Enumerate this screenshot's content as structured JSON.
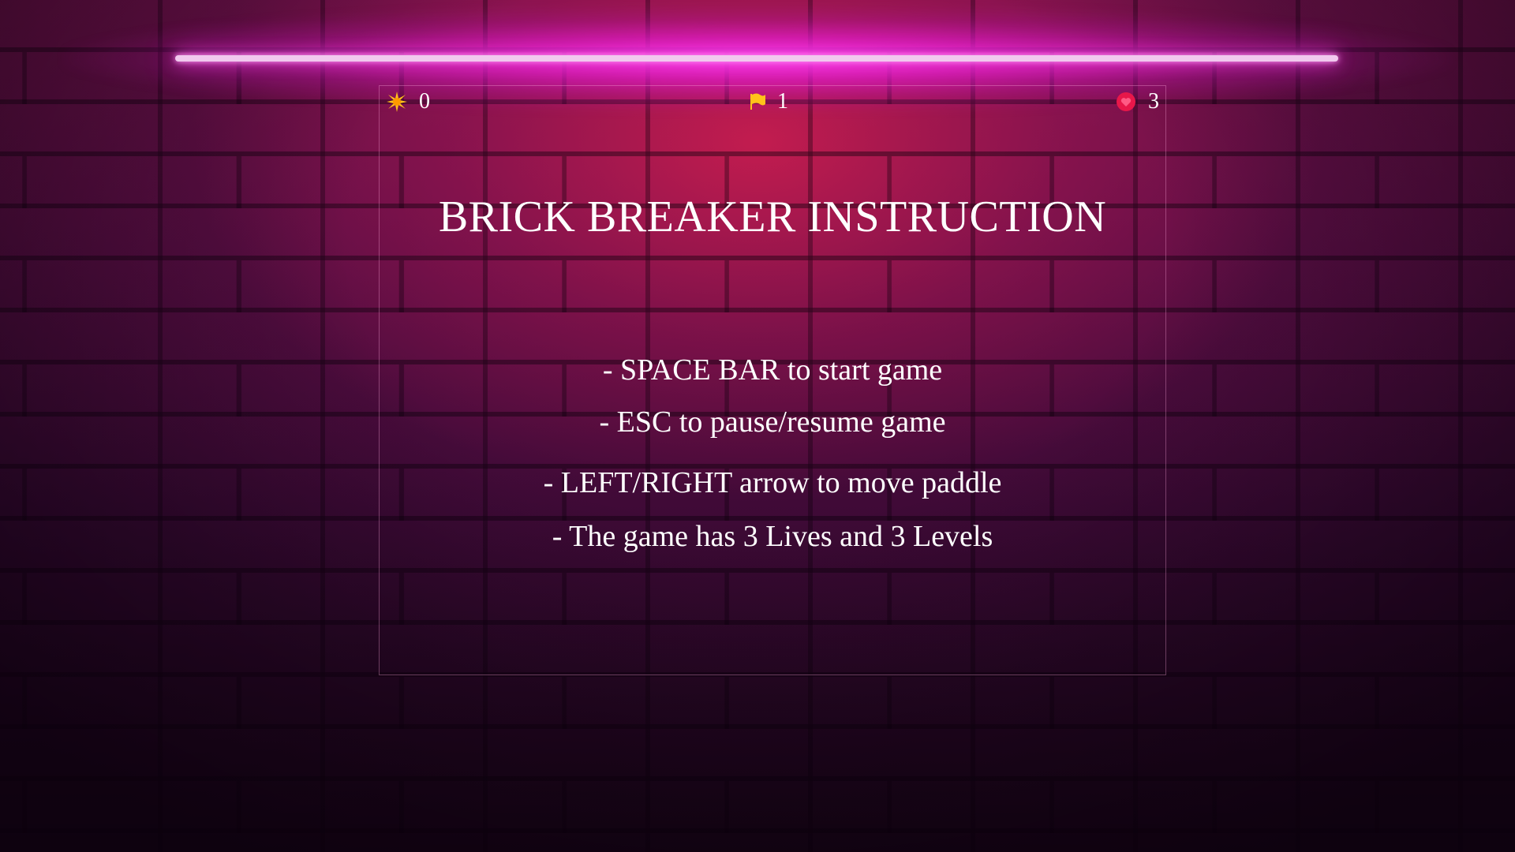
{
  "hud": {
    "score": "0",
    "score_icon": "star-burst-icon",
    "level": "1",
    "level_icon": "flag-icon",
    "lives": "3",
    "lives_icon": "heart-icon"
  },
  "screen": {
    "title": "BRICK BREAKER INSTRUCTION",
    "instructions": [
      "- SPACE BAR to start game",
      "- ESC to pause/resume game",
      "- LEFT/RIGHT arrow to move paddle",
      "- The game has 3 Lives and 3 Levels"
    ]
  },
  "colors": {
    "neon": "#ff4de8",
    "text": "#ffffff",
    "star": "#ffc21a",
    "flag": "#ffc21a",
    "heart": "#e8174a"
  }
}
